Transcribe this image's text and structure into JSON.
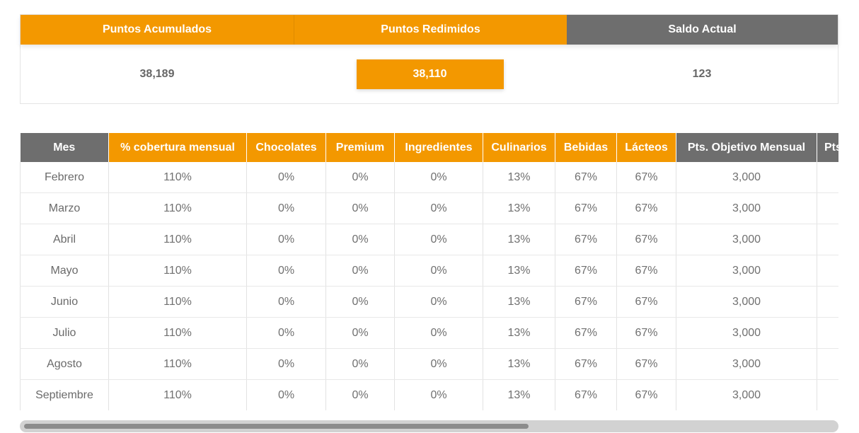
{
  "summary": {
    "headers": {
      "accumulated": "Puntos Acumulados",
      "redeemed": "Puntos Redimidos",
      "balance": "Saldo Actual"
    },
    "values": {
      "accumulated": "38,189",
      "redeemed": "38,110",
      "balance": "123"
    }
  },
  "table": {
    "columns": [
      "Mes",
      "% cobertura mensual",
      "Chocolates",
      "Premium",
      "Ingredientes",
      "Culinarios",
      "Bebidas",
      "Lácteos",
      "Pts. Objetivo Mensual",
      "Pts"
    ],
    "rows": [
      [
        "Febrero",
        "110%",
        "0%",
        "0%",
        "0%",
        "13%",
        "67%",
        "67%",
        "3,000",
        ""
      ],
      [
        "Marzo",
        "110%",
        "0%",
        "0%",
        "0%",
        "13%",
        "67%",
        "67%",
        "3,000",
        ""
      ],
      [
        "Abril",
        "110%",
        "0%",
        "0%",
        "0%",
        "13%",
        "67%",
        "67%",
        "3,000",
        ""
      ],
      [
        "Mayo",
        "110%",
        "0%",
        "0%",
        "0%",
        "13%",
        "67%",
        "67%",
        "3,000",
        ""
      ],
      [
        "Junio",
        "110%",
        "0%",
        "0%",
        "0%",
        "13%",
        "67%",
        "67%",
        "3,000",
        ""
      ],
      [
        "Julio",
        "110%",
        "0%",
        "0%",
        "0%",
        "13%",
        "67%",
        "67%",
        "3,000",
        ""
      ],
      [
        "Agosto",
        "110%",
        "0%",
        "0%",
        "0%",
        "13%",
        "67%",
        "67%",
        "3,000",
        ""
      ],
      [
        "Septiembre",
        "110%",
        "0%",
        "0%",
        "0%",
        "13%",
        "67%",
        "67%",
        "3,000",
        ""
      ]
    ]
  },
  "colors": {
    "accent_orange": "#f39800",
    "header_gray": "#6e6e6e"
  }
}
